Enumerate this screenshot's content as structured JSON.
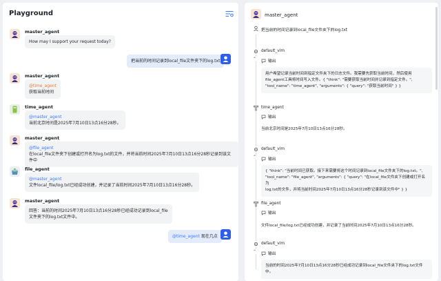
{
  "playground": {
    "title": "Playground",
    "settings_icon": "settings-sliders-icon"
  },
  "chat": [
    {
      "role": "agent",
      "name": "master_agent",
      "text": "How may I support your request today?"
    },
    {
      "role": "user",
      "text": "把当前的时间记录到local_file文件夹下的log.txt"
    },
    {
      "role": "agent",
      "name": "master_agent",
      "mention": "@time_agent",
      "text": "获取当前时间"
    },
    {
      "role": "tool",
      "name": "time_agent",
      "mention": "@master_agent",
      "text": "当前北京时间是2025年7月10日13点16分28秒。"
    },
    {
      "role": "agent",
      "name": "master_agent",
      "mention": "@file_agent",
      "text": "在local_file文件夹下创建或打开名为log.txt的文件，并将当前时间2025年7月10日13点16分28秒记录到该文件中"
    },
    {
      "role": "tool",
      "name": "file_agent",
      "mention": "@master_agent",
      "text": "文件local_file/log.txt已经成功创建，并记录了当前时间2025年7月10日13点16分28秒。"
    },
    {
      "role": "agent",
      "name": "master_agent",
      "text_line1": "回答：当前的时间2025年7月10日13点16分28秒已经成功记录到local_file",
      "text_line2": "文件夹下的log.txt文件中。"
    },
    {
      "role": "user",
      "mention": "@time_agent",
      "text": "现在几点"
    }
  ],
  "trace": {
    "title": "master_agent",
    "input": "把当前的时间记录到local_file文件夹下的log.txt",
    "output_label": "输出",
    "steps": [
      {
        "label": "default_vlm",
        "output_line1": "用户希望记录当前时间到指定文件夹下的日志文件。我需要先获取当前时间，然后使用",
        "output_line2": "file_agent工具将时间写入文件。{ \"think\": \"需要获取当前时间并记录到指定文件。\",",
        "output_line3": "\"tool_name\": \"time_agent\", \"arguments\": { \"query\": \"获取当前时间\" } }"
      },
      {
        "label": "time_agent",
        "output_line1": "当前北京时间是2025年7月10日13点16分28秒。"
      },
      {
        "label": "default_vlm",
        "output_line1": "{ \"think\": \"当前时间已获取。接下来需要将这个时间记录到local_file文件夹下的log.txt。\",",
        "output_line2": "\"tool_name\": \"file_agent\", \"arguments\": { \"query\": \"在local_file文件夹下创建或打开名为",
        "output_line3": "log.txt的文件，并将当前时间2025年7月10日13点16分28秒记录到该文件中\" } }"
      },
      {
        "label": "file_agent",
        "output_line1": "文件local_file/log.txt已经成功创建，并记录了当前时间2025年7月10日13点16分28秒。"
      },
      {
        "label": "default_vlm",
        "output_line1": "当前的时间2025年7月10日13点16分28秒已经成功记录到local_file文件夹下的log.txt文件中。"
      }
    ]
  }
}
